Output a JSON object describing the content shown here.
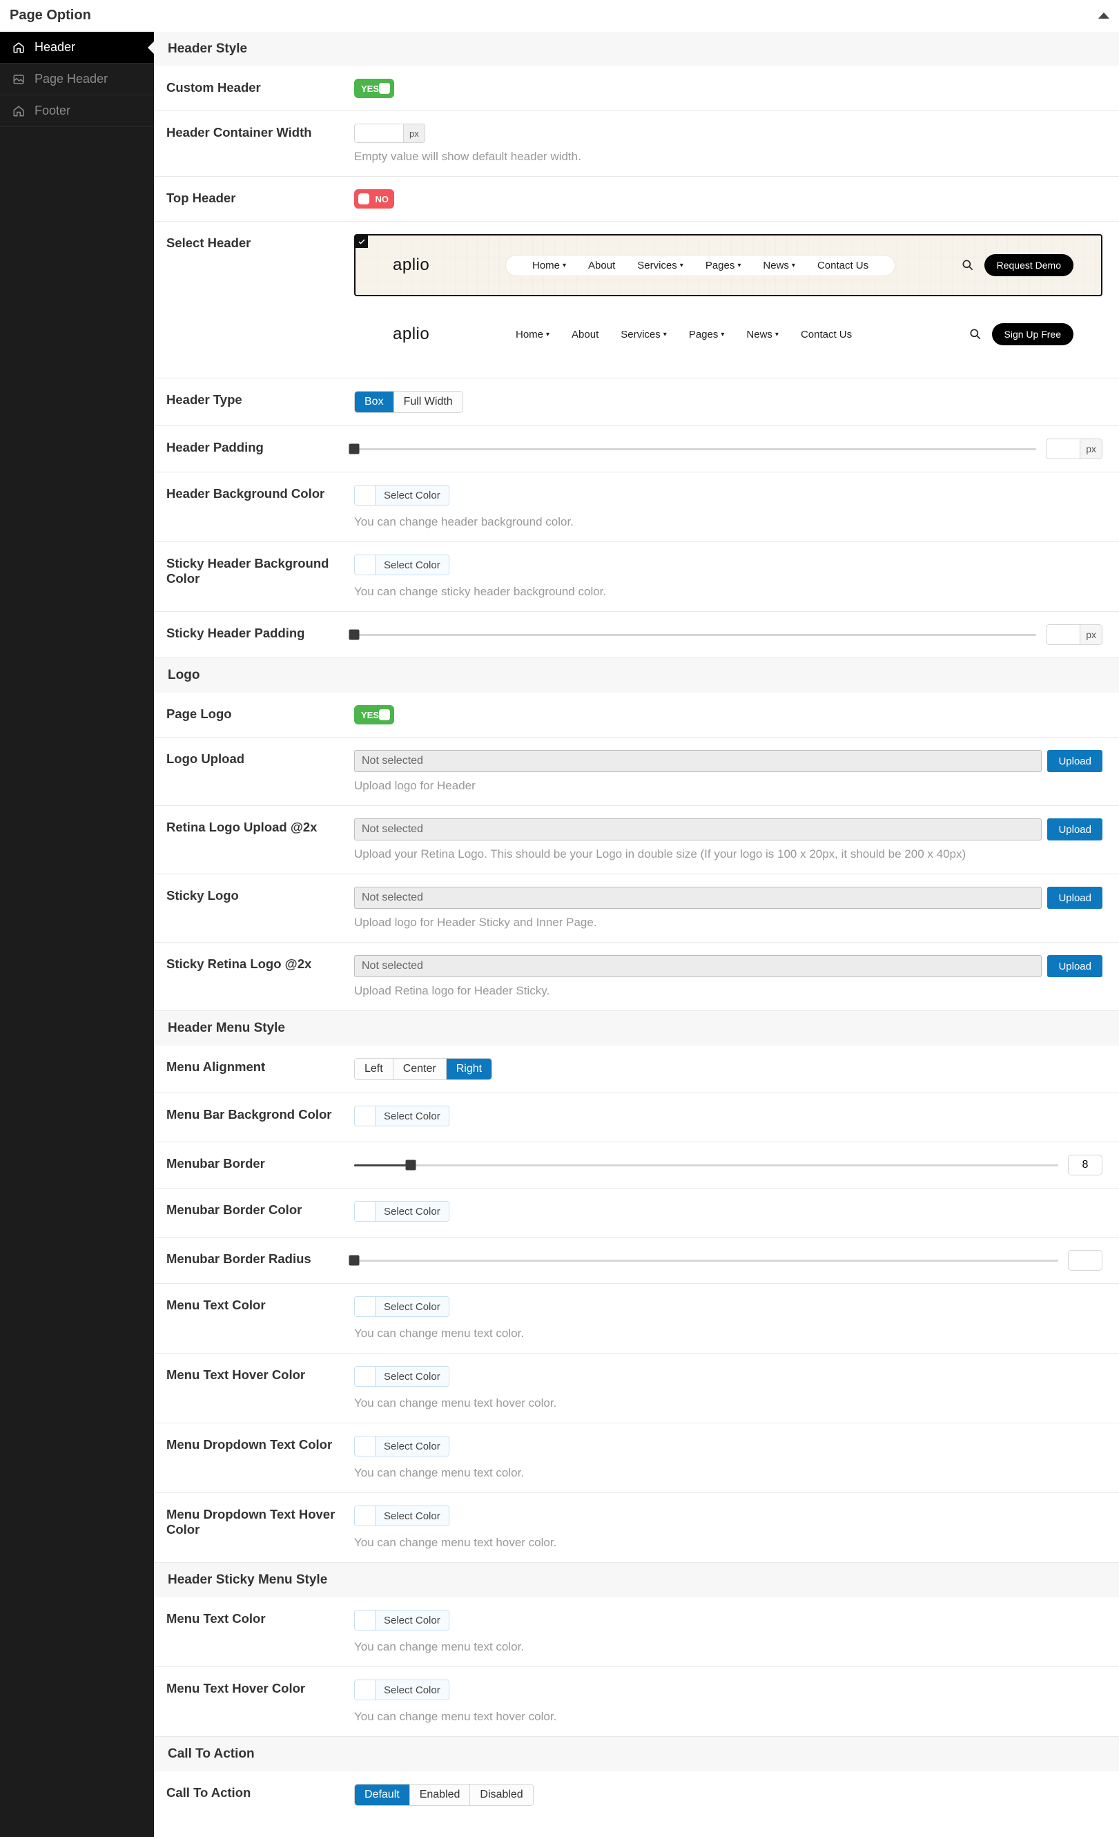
{
  "header": {
    "title": "Page Option"
  },
  "sidebar": {
    "items": [
      {
        "label": "Header"
      },
      {
        "label": "Page Header"
      },
      {
        "label": "Footer"
      }
    ]
  },
  "sections": {
    "header_style": "Header Style",
    "logo": "Logo",
    "menu_style": "Header Menu Style",
    "sticky_menu": "Header Sticky Menu Style",
    "cta": "Call To Action"
  },
  "labels": {
    "custom_header": "Custom Header",
    "container_width": "Header Container Width",
    "top_header": "Top Header",
    "select_header": "Select Header",
    "header_type": "Header Type",
    "header_padding": "Header Padding",
    "header_bg": "Header Background Color",
    "sticky_bg": "Sticky Header Background Color",
    "sticky_padding": "Sticky Header Padding",
    "page_logo": "Page Logo",
    "logo_upload": "Logo Upload",
    "retina_upload": "Retina Logo Upload @2x",
    "sticky_logo": "Sticky Logo",
    "sticky_retina": "Sticky Retina Logo @2x",
    "menu_align": "Menu Alignment",
    "menubar_bg": "Menu Bar Backgrond Color",
    "menubar_border": "Menubar Border",
    "menubar_border_color": "Menubar Border Color",
    "menubar_radius": "Menubar Border Radius",
    "menu_text_color": "Menu Text Color",
    "menu_text_hover": "Menu Text Hover Color",
    "menu_dd_text": "Menu Dropdown Text Color",
    "menu_dd_hover": "Menu Dropdown Text Hover Color",
    "sticky_menu_text": "Menu Text Color",
    "sticky_menu_hover": "Menu Text Hover Color",
    "cta": "Call To Action"
  },
  "hints": {
    "container_width": "Empty value will show default header width.",
    "header_bg": "You can change header background color.",
    "sticky_bg": "You can change sticky header background color.",
    "logo_upload": "Upload logo for Header",
    "retina_upload": "Upload your Retina Logo. This should be your Logo in double size (If your logo is 100 x 20px, it should be 200 x 40px)",
    "sticky_logo": "Upload logo for Header Sticky and Inner Page.",
    "sticky_retina": "Upload Retina logo for Header Sticky.",
    "menu_text_color": "You can change menu text color.",
    "menu_text_hover": "You can change menu text hover color.",
    "menu_dd_text": "You can change menu text color.",
    "menu_dd_hover": "You can change menu text hover color.",
    "sticky_menu_text": "You can change menu text color.",
    "sticky_menu_hover": "You can change menu text hover color."
  },
  "values": {
    "toggle_yes": "YES",
    "toggle_no": "NO",
    "px": "px",
    "select_color": "Select Color",
    "not_selected": "Not selected",
    "upload": "Upload",
    "header_type": [
      "Box",
      "Full Width"
    ],
    "menu_align": [
      "Left",
      "Center",
      "Right"
    ],
    "cta": [
      "Default",
      "Enabled",
      "Disabled"
    ],
    "menubar_border": 8
  },
  "preview": {
    "brand": "aplio",
    "nav": [
      "Home",
      "About",
      "Services",
      "Pages",
      "News",
      "Contact Us"
    ],
    "dd_indices": [
      0,
      2,
      3,
      4
    ],
    "cta1": "Request Demo",
    "cta2": "Sign Up Free"
  }
}
